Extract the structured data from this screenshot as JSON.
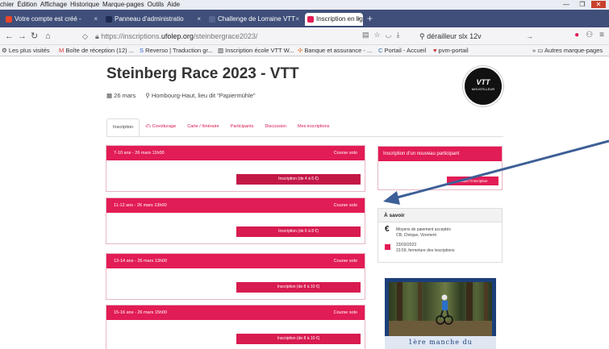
{
  "window": {
    "menus": [
      "chier",
      "Édition",
      "Affichage",
      "Historique",
      "Marque-pages",
      "Outils",
      "Aide"
    ]
  },
  "tabs": [
    {
      "label": "Votre compte est créé -",
      "icon_color": "#e8472b"
    },
    {
      "label": "Panneau d'administratio",
      "icon_color": "#2b3a6b"
    },
    {
      "label": "Challenge de Lorraine VTT",
      "icon_color": "#3f4f7a"
    },
    {
      "label": "Inscription en ligne - UF",
      "icon_color": "#e21c55"
    }
  ],
  "nav": {
    "url_prefix": "https://inscriptions.",
    "url_host": "ufolep.org",
    "url_path": "/steinbergrace2023/",
    "search": "dérailleur slx 12v"
  },
  "bookmarks": [
    "Les plus visités",
    "Boîte de réception (12) ...",
    "Reverso | Traduction gr...",
    "Inscription école VTT W...",
    "Banque et assurance - ...",
    "Portail - Accueil",
    "pvm-portail",
    "Autres marque-pages"
  ],
  "page": {
    "title": "Steinberg Race 2023 - VTT",
    "date": "26 mars",
    "location": "Hombourg-Haut, lieu dit \"Papiermühle\"",
    "logo_text": "VTT",
    "logo_sub": "MOUSTILLEUR",
    "tabs": [
      "Inscription",
      "Covoiturage",
      "Carte / Itinéraire",
      "Participants",
      "Discussion",
      "Mes inscriptions"
    ],
    "courses": [
      {
        "head": "7-10 ans - 26 mars 11h00",
        "type": "Course solo",
        "button": "Inscription (de 4 à 6 €)"
      },
      {
        "head": "11-12 ans - 26 mars 13h00",
        "type": "Course solo",
        "button": "Inscription (de 6 à 8 €)"
      },
      {
        "head": "13-14 ans - 26 mars 13h00",
        "type": "Course solo",
        "button": "Inscription (de 8 à 10 €)"
      },
      {
        "head": "15-16 ans - 26 mars 15h00",
        "type": "Course solo",
        "button": "Inscription (de 8 à 10 €)"
      }
    ],
    "new_participant": {
      "title": "Inscription d'un nouveau participant",
      "button": "Valider l'inscription"
    },
    "savoir": {
      "title": "À savoir",
      "payment_line1": "Moyens de paiement acceptés",
      "payment_line2": "CB, Chèque, Virement",
      "deadline_line1": "23/03/2023",
      "deadline_line2": "23:59, fermeture des inscriptions"
    },
    "poster_text": "1ère manche du"
  },
  "colors": {
    "brand": "#e21c55",
    "tabbar": "#3f4f7a",
    "arrow": "#3d5f97"
  }
}
